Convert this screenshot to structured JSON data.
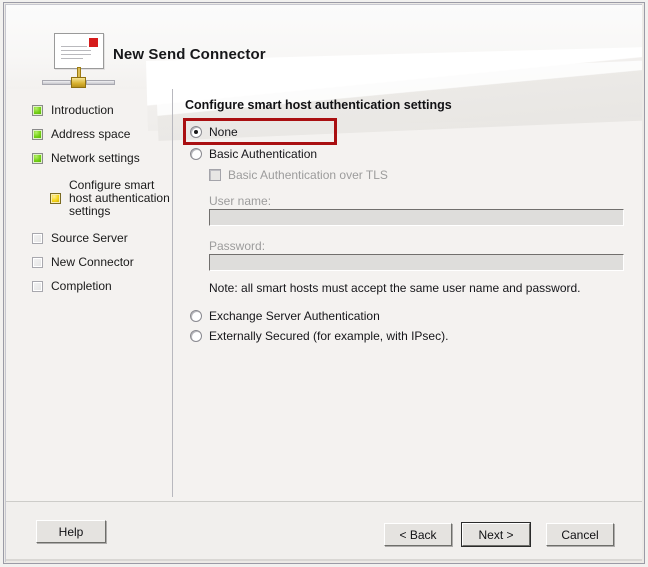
{
  "window": {
    "title": "New Send Connector",
    "app_icon": "send-connector-envelope-icon"
  },
  "sidebar": {
    "items": [
      {
        "label": "Introduction",
        "state": "done"
      },
      {
        "label": "Address space",
        "state": "done"
      },
      {
        "label": "Network settings",
        "state": "done"
      },
      {
        "label": "Configure smart host authentication settings",
        "state": "current",
        "sub": true
      },
      {
        "label": "Source Server",
        "state": "pending"
      },
      {
        "label": "New Connector",
        "state": "pending"
      },
      {
        "label": "Completion",
        "state": "pending"
      }
    ]
  },
  "main": {
    "section_title": "Configure smart host authentication settings",
    "options": [
      {
        "label": "None",
        "checked": true,
        "enabled": true,
        "highlighted": true
      },
      {
        "label": "Basic Authentication",
        "checked": false,
        "enabled": true
      },
      {
        "label": "Exchange Server Authentication",
        "checked": false,
        "enabled": true
      },
      {
        "label": "Externally Secured (for example, with IPsec).",
        "checked": false,
        "enabled": true
      }
    ],
    "tls_checkbox": {
      "label": "Basic Authentication over TLS",
      "checked": false,
      "enabled": false
    },
    "username": {
      "label": "User name:",
      "value": "",
      "placeholder": ""
    },
    "password": {
      "label": "Password:",
      "value": "",
      "placeholder": ""
    },
    "note": "Note: all smart hosts must accept the same user name and password.",
    "highlight_color": "#a90f11"
  },
  "footer": {
    "help_label": "Help",
    "back_label": "< Back",
    "next_label": "Next >",
    "cancel_label": "Cancel"
  }
}
